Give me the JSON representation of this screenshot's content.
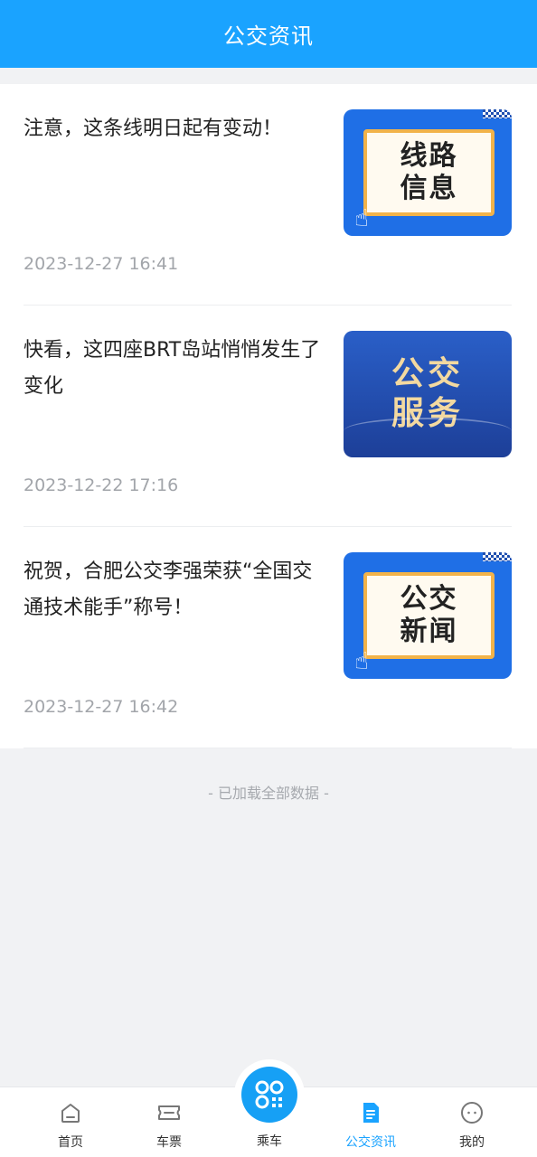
{
  "header": {
    "title": "公交资讯"
  },
  "news": [
    {
      "title": "注意，这条线明日起有变动！",
      "date": "2023-12-27 16:41",
      "thumb_lines": [
        "线路",
        "信息"
      ]
    },
    {
      "title": "快看，这四座BRT岛站悄悄发生了变化",
      "date": "2023-12-22 17:16",
      "thumb_lines": [
        "公交",
        "服务"
      ]
    },
    {
      "title": "祝贺，合肥公交李强荣获“全国交通技术能手”称号！",
      "date": "2023-12-27 16:42",
      "thumb_lines": [
        "公交",
        "新闻"
      ]
    }
  ],
  "footer_text": "- 已加载全部数据 -",
  "tabbar": {
    "home": "首页",
    "tickets": "车票",
    "ride": "乘车",
    "news": "公交资讯",
    "mine": "我的"
  },
  "colors": {
    "primary": "#1aa3ff",
    "text": "#222222",
    "muted": "#a2a5aa"
  }
}
